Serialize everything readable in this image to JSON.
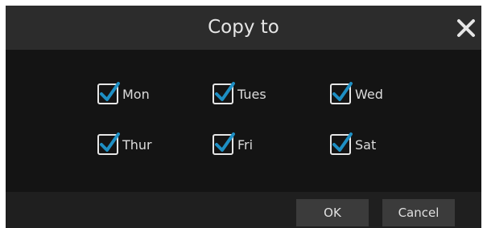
{
  "dialog": {
    "title": "Copy to",
    "close_icon": "close-icon",
    "days": [
      {
        "label": "Mon",
        "checked": true
      },
      {
        "label": "Tues",
        "checked": true
      },
      {
        "label": "Wed",
        "checked": true
      },
      {
        "label": "Thur",
        "checked": true
      },
      {
        "label": "Fri",
        "checked": true
      },
      {
        "label": "Sat",
        "checked": true
      }
    ],
    "ok_label": "OK",
    "cancel_label": "Cancel"
  },
  "colors": {
    "check_accent": "#1e8fc4",
    "title_bar": "#2c2c2c",
    "content_bg": "#141414",
    "button_bg": "#3b3b3b"
  }
}
